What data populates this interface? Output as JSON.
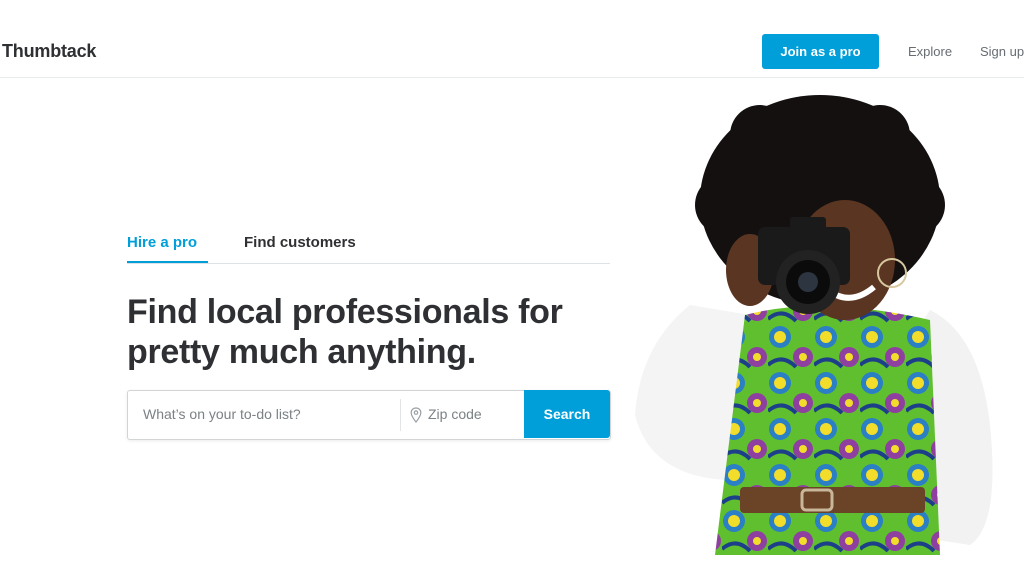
{
  "header": {
    "logo": "Thumbtack",
    "join_label": "Join as a pro",
    "explore_label": "Explore",
    "signup_label": "Sign up"
  },
  "tabs": [
    {
      "label": "Hire a pro",
      "active": true
    },
    {
      "label": "Find customers",
      "active": false
    }
  ],
  "hero": {
    "headline": "Find local professionals for pretty much anything."
  },
  "search": {
    "todo_placeholder": "What’s on your to-do list?",
    "zip_placeholder": "Zip code",
    "button_label": "Search"
  },
  "colors": {
    "accent": "#009fd9",
    "text": "#2f3033"
  },
  "icons": [
    "location-pin-icon"
  ]
}
